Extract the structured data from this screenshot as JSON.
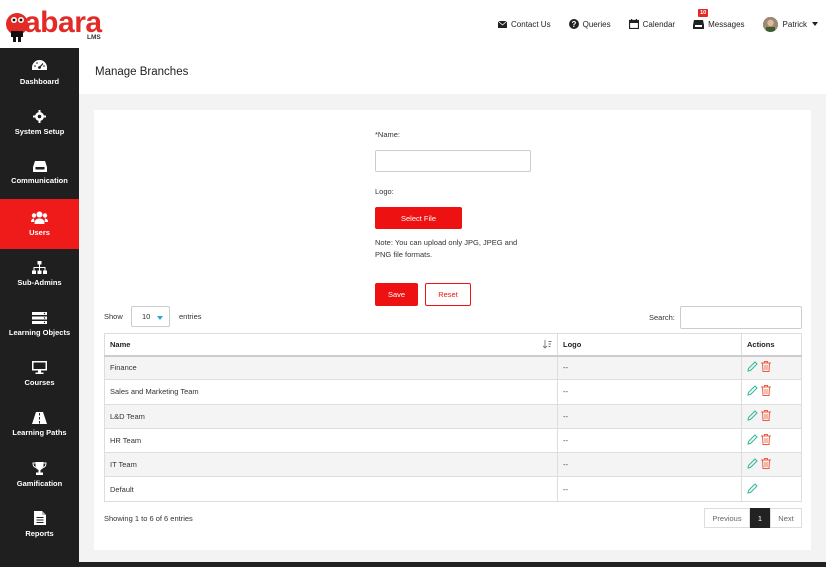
{
  "brand": {
    "word": "abara",
    "sub": "LMS",
    "color": "#e32a26"
  },
  "topnav": {
    "contact": "Contact Us",
    "queries": "Queries",
    "calendar": "Calendar",
    "messages": "Messages",
    "messages_badge": "10",
    "user": "Patrick"
  },
  "sidebar": {
    "items": [
      {
        "label": "Dashboard",
        "icon": "dashboard-icon"
      },
      {
        "label": "System Setup",
        "icon": "gear-icon"
      },
      {
        "label": "Communication",
        "icon": "inbox-icon"
      },
      {
        "label": "Users",
        "icon": "users-icon",
        "active": true
      },
      {
        "label": "Sub-Admins",
        "icon": "sitemap-icon"
      },
      {
        "label": "Learning Objects",
        "icon": "server-icon"
      },
      {
        "label": "Courses",
        "icon": "monitor-icon"
      },
      {
        "label": "Learning Paths",
        "icon": "road-icon"
      },
      {
        "label": "Gamification",
        "icon": "trophy-icon"
      },
      {
        "label": "Reports",
        "icon": "file-icon"
      }
    ]
  },
  "page": {
    "title": "Manage Branches"
  },
  "form": {
    "name_label": "*Name:",
    "name_value": "",
    "logo_label": "Logo:",
    "select_file": "Select File",
    "note": "Note: You can upload only JPG, JPEG and PNG file formats.",
    "save": "Save",
    "reset": "Reset"
  },
  "table_controls": {
    "show": "Show",
    "entries_value": "10",
    "entries": "entries",
    "search": "Search:"
  },
  "table": {
    "headers": {
      "name": "Name",
      "logo": "Logo",
      "actions": "Actions"
    },
    "rows": [
      {
        "name": "Finance",
        "logo": "--"
      },
      {
        "name": "Sales and Marketing Team",
        "logo": "--"
      },
      {
        "name": "L&D Team",
        "logo": "--"
      },
      {
        "name": "HR Team",
        "logo": "--"
      },
      {
        "name": "IT Team",
        "logo": "--"
      },
      {
        "name": "Default",
        "logo": "--"
      }
    ]
  },
  "footer": {
    "info": "Showing 1 to 6 of 6 entries",
    "previous": "Previous",
    "page": "1",
    "next": "Next"
  }
}
